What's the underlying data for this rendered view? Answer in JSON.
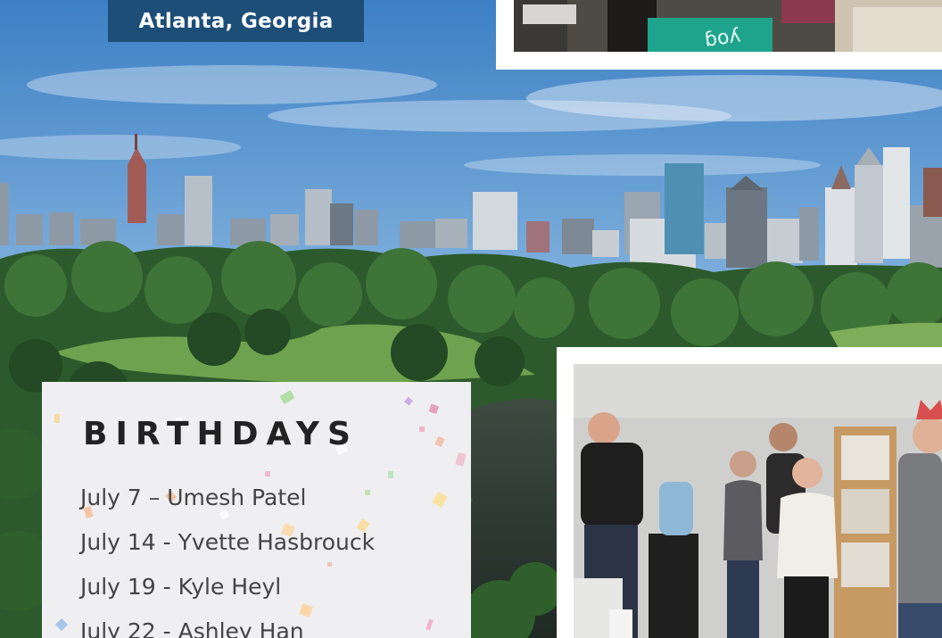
{
  "location": {
    "label": "Atlanta, Georgia"
  },
  "birthdays": {
    "title": "BIRTHDAYS",
    "entries": [
      "July 7 – Umesh Patel",
      "July 14 - Yvette Hasbrouck",
      "July 19 - Kyle Heyl",
      "July 22 - Ashley Han"
    ]
  },
  "colors": {
    "location_tag_bg": "#1d4e78",
    "card_bg": "#efeff1",
    "title_text": "#222222",
    "entry_text": "#444444"
  }
}
